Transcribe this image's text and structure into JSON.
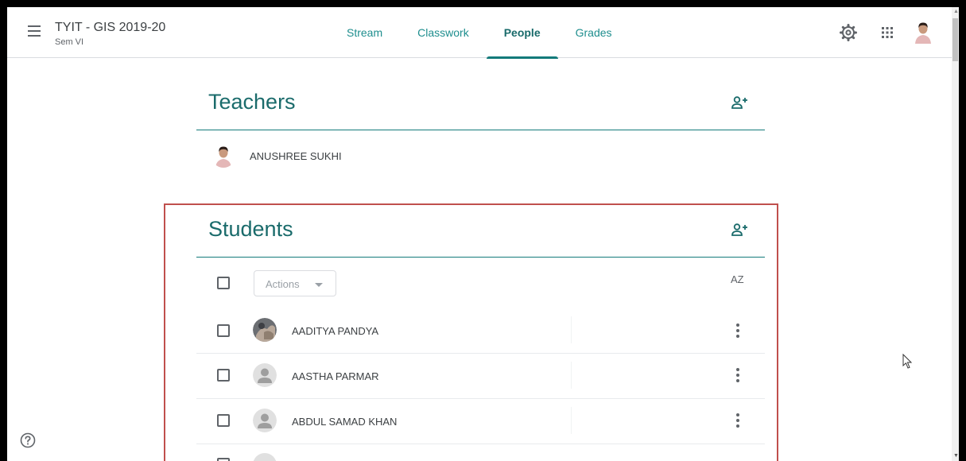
{
  "header": {
    "class_title": "TYIT - GIS 2019-20",
    "class_subtitle": "Sem VI",
    "tabs": [
      {
        "label": "Stream"
      },
      {
        "label": "Classwork"
      },
      {
        "label": "People"
      },
      {
        "label": "Grades"
      }
    ],
    "active_tab": "People"
  },
  "teachers": {
    "title": "Teachers",
    "list": [
      {
        "name": "ANUSHREE SUKHI"
      }
    ]
  },
  "students": {
    "title": "Students",
    "actions_label": "Actions",
    "sort_label": "AZ",
    "list": [
      {
        "name": "AADITYA PANDYA"
      },
      {
        "name": "AASTHA PARMAR"
      },
      {
        "name": "ABDUL SAMAD KHAN"
      }
    ]
  },
  "colors": {
    "accent": "#1a6b6b",
    "highlight": "#c0504d"
  }
}
